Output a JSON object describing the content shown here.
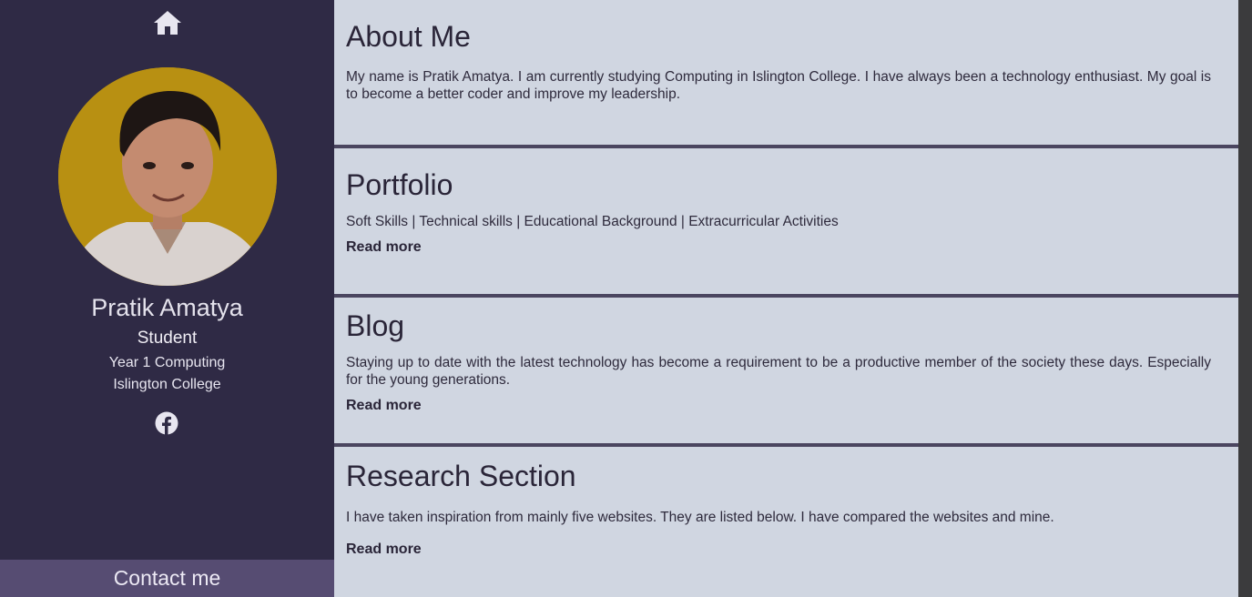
{
  "sidebar": {
    "home_icon": "home-icon",
    "profile": {
      "name": "Pratik Amatya",
      "role": "Student",
      "line1": "Year 1 Computing",
      "line2": "Islington College"
    },
    "social_icon": "facebook-icon",
    "contact_label": "Contact me"
  },
  "sections": [
    {
      "title": "About Me",
      "text": "My name is Pratik Amatya. I am currently studying Computing in Islington College. I have always been a technology enthusiast. My goal is to become a better coder and improve my leadership."
    },
    {
      "title": "Portfolio",
      "text": "Soft Skills | Technical skills | Educational Background | Extracurricular Activities",
      "link": "Read more"
    },
    {
      "title": "Blog",
      "text": "Staying up to date with the latest technology has become a requirement to be a productive member of the society these days. Especially for the young generations.",
      "link": "Read more"
    },
    {
      "title": "Research Section",
      "text": "I have taken inspiration from mainly five websites. They are listed below. I have compared the websites and mine.",
      "link": "Read more"
    }
  ],
  "colors": {
    "sidebar_bg": "#2f2a45",
    "card_bg": "#d0d6e1",
    "contact_bg": "#564c72",
    "avatar_bg": "#b89012"
  }
}
